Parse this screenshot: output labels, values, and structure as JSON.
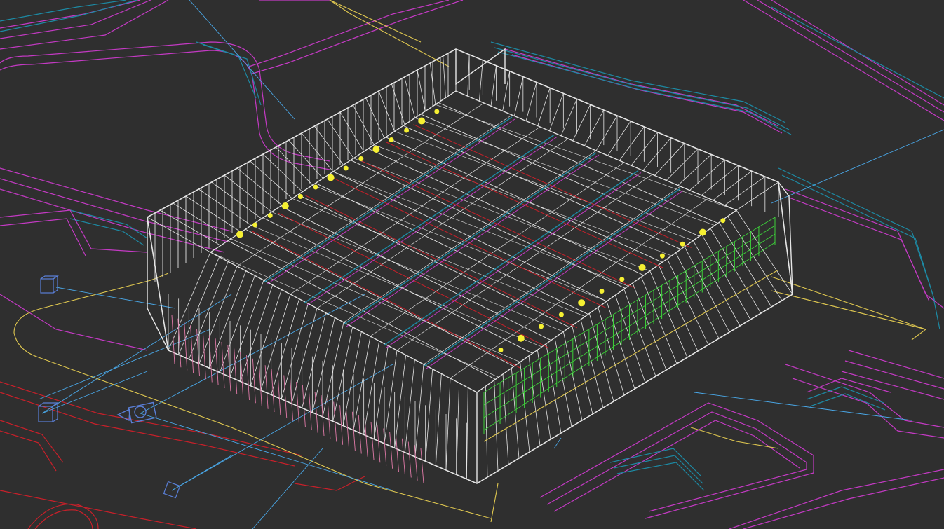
{
  "viewport": {
    "background": "#2f2f2f",
    "render_mode": "wireframe",
    "view": "perspective"
  },
  "colors": {
    "structure": "#e6e6e6",
    "terrain_magenta": "#c43ac4",
    "terrain_teal": "#1d8aa4",
    "site_red": "#c8202a",
    "light_bulbs": "#f5f032",
    "camera_gizmo": "#5a7fd6",
    "target_lines": "#4aa8e8",
    "site_boundary": "#e0c850",
    "glazing_green": "#3dd23a",
    "facade_pink": "#e07aa8"
  },
  "icons": [
    "camera-icon",
    "camera-target-icon",
    "light-gizmo-icon"
  ],
  "objects": [
    "stadium-building",
    "roof-truss-grid",
    "facade-glazing",
    "light-fixtures",
    "terrain-mesh",
    "site-boundary",
    "camera",
    "site-plan-red"
  ]
}
